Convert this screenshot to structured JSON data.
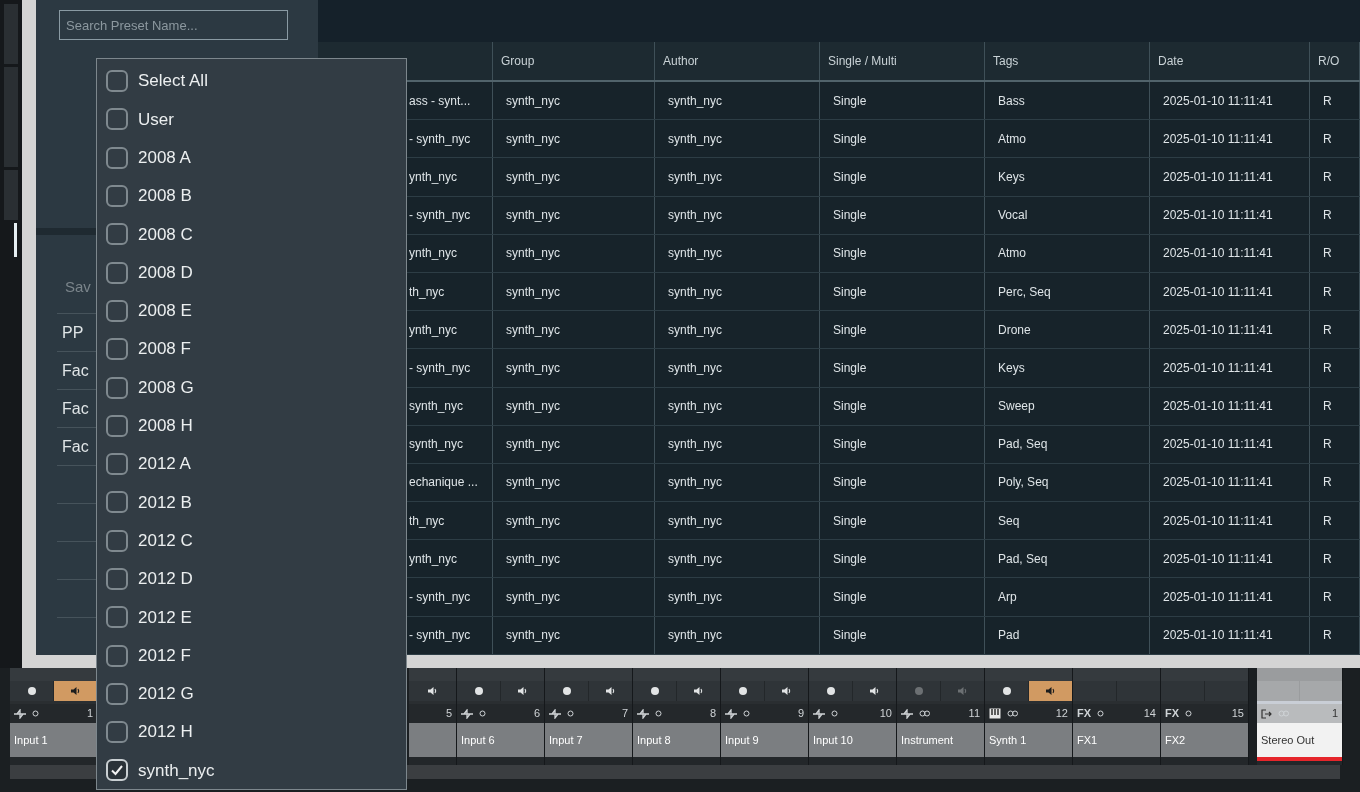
{
  "search": {
    "placeholder": "Search Preset Name..."
  },
  "sidebar": {
    "heading": "Sav",
    "items": [
      {
        "label": "PP"
      },
      {
        "label": "Fac"
      },
      {
        "label": "Fac"
      },
      {
        "label": "Fac"
      }
    ]
  },
  "table": {
    "columns": [
      "Group",
      "Author",
      "Single / Multi",
      "Tags",
      "Date",
      "R/O"
    ],
    "rows": [
      {
        "name": "ass - synt...",
        "group": "synth_nyc",
        "author": "synth_nyc",
        "type": "Single",
        "tags": "Bass",
        "date": "2025-01-10 11:11:41",
        "ro": "R"
      },
      {
        "name": "- synth_nyc",
        "group": "synth_nyc",
        "author": "synth_nyc",
        "type": "Single",
        "tags": "Atmo",
        "date": "2025-01-10 11:11:41",
        "ro": "R"
      },
      {
        "name": "ynth_nyc",
        "group": "synth_nyc",
        "author": "synth_nyc",
        "type": "Single",
        "tags": "Keys",
        "date": "2025-01-10 11:11:41",
        "ro": "R"
      },
      {
        "name": "- synth_nyc",
        "group": "synth_nyc",
        "author": "synth_nyc",
        "type": "Single",
        "tags": "Vocal",
        "date": "2025-01-10 11:11:41",
        "ro": "R"
      },
      {
        "name": "ynth_nyc",
        "group": "synth_nyc",
        "author": "synth_nyc",
        "type": "Single",
        "tags": "Atmo",
        "date": "2025-01-10 11:11:41",
        "ro": "R"
      },
      {
        "name": "th_nyc",
        "group": "synth_nyc",
        "author": "synth_nyc",
        "type": "Single",
        "tags": "Perc, Seq",
        "date": "2025-01-10 11:11:41",
        "ro": "R"
      },
      {
        "name": "ynth_nyc",
        "group": "synth_nyc",
        "author": "synth_nyc",
        "type": "Single",
        "tags": "Drone",
        "date": "2025-01-10 11:11:41",
        "ro": "R"
      },
      {
        "name": "- synth_nyc",
        "group": "synth_nyc",
        "author": "synth_nyc",
        "type": "Single",
        "tags": "Keys",
        "date": "2025-01-10 11:11:41",
        "ro": "R"
      },
      {
        "name": "synth_nyc",
        "group": "synth_nyc",
        "author": "synth_nyc",
        "type": "Single",
        "tags": "Sweep",
        "date": "2025-01-10 11:11:41",
        "ro": "R"
      },
      {
        "name": "synth_nyc",
        "group": "synth_nyc",
        "author": "synth_nyc",
        "type": "Single",
        "tags": "Pad, Seq",
        "date": "2025-01-10 11:11:41",
        "ro": "R"
      },
      {
        "name": "echanique ...",
        "group": "synth_nyc",
        "author": "synth_nyc",
        "type": "Single",
        "tags": "Poly, Seq",
        "date": "2025-01-10 11:11:41",
        "ro": "R"
      },
      {
        "name": "th_nyc",
        "group": "synth_nyc",
        "author": "synth_nyc",
        "type": "Single",
        "tags": "Seq",
        "date": "2025-01-10 11:11:41",
        "ro": "R"
      },
      {
        "name": "ynth_nyc",
        "group": "synth_nyc",
        "author": "synth_nyc",
        "type": "Single",
        "tags": "Pad, Seq",
        "date": "2025-01-10 11:11:41",
        "ro": "R"
      },
      {
        "name": "- synth_nyc",
        "group": "synth_nyc",
        "author": "synth_nyc",
        "type": "Single",
        "tags": "Arp",
        "date": "2025-01-10 11:11:41",
        "ro": "R"
      },
      {
        "name": "- synth_nyc",
        "group": "synth_nyc",
        "author": "synth_nyc",
        "type": "Single",
        "tags": "Pad",
        "date": "2025-01-10 11:11:41",
        "ro": "R"
      }
    ]
  },
  "group_filter": [
    {
      "label": "Select All",
      "checked": false
    },
    {
      "label": "User",
      "checked": false
    },
    {
      "label": "2008 A",
      "checked": false
    },
    {
      "label": "2008 B",
      "checked": false
    },
    {
      "label": "2008 C",
      "checked": false
    },
    {
      "label": "2008 D",
      "checked": false
    },
    {
      "label": "2008 E",
      "checked": false
    },
    {
      "label": "2008 F",
      "checked": false
    },
    {
      "label": "2008 G",
      "checked": false
    },
    {
      "label": "2008 H",
      "checked": false
    },
    {
      "label": "2012 A",
      "checked": false
    },
    {
      "label": "2012 B",
      "checked": false
    },
    {
      "label": "2012 C",
      "checked": false
    },
    {
      "label": "2012 D",
      "checked": false
    },
    {
      "label": "2012 E",
      "checked": false
    },
    {
      "label": "2012 F",
      "checked": false
    },
    {
      "label": "2012 G",
      "checked": false
    },
    {
      "label": "2012 H",
      "checked": false
    },
    {
      "label": "synth_nyc",
      "checked": true
    }
  ],
  "mixer": [
    {
      "kind": "audio",
      "name": "Input 1",
      "number": "1",
      "monitor": true
    },
    {
      "kind": "partial",
      "number": "5",
      "monitor": false
    },
    {
      "kind": "audio",
      "name": "Input 6",
      "number": "6",
      "monitor": false
    },
    {
      "kind": "audio",
      "name": "Input 7",
      "number": "7",
      "monitor": false
    },
    {
      "kind": "audio",
      "name": "Input 8",
      "number": "8",
      "monitor": false
    },
    {
      "kind": "audio",
      "name": "Input 9",
      "number": "9",
      "monitor": false
    },
    {
      "kind": "audio",
      "name": "Input 10",
      "number": "10",
      "monitor": false
    },
    {
      "kind": "instrument",
      "name": "Instrument",
      "number": "11",
      "monitor": false
    },
    {
      "kind": "synth",
      "name": "Synth 1",
      "number": "12",
      "monitor": true
    },
    {
      "kind": "fx",
      "type_label": "FX",
      "name": "FX1",
      "number": "14"
    },
    {
      "kind": "fx",
      "type_label": "FX",
      "name": "FX2",
      "number": "15"
    },
    {
      "kind": "output",
      "name": "Stereo Out",
      "number": "1"
    }
  ]
}
